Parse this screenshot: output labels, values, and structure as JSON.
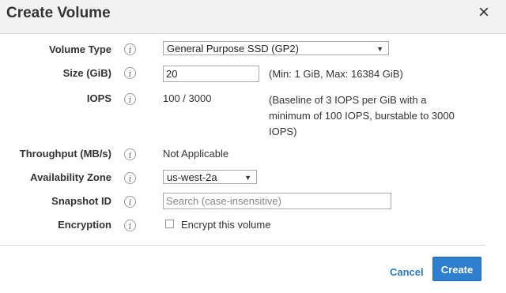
{
  "dialog": {
    "title": "Create Volume",
    "close_glyph": "×"
  },
  "form": {
    "volume_type": {
      "label": "Volume Type",
      "value": "General Purpose SSD (GP2)"
    },
    "size": {
      "label": "Size (GiB)",
      "value": "20",
      "hint": "(Min: 1 GiB, Max: 16384 GiB)"
    },
    "iops": {
      "label": "IOPS",
      "value": "100 / 3000",
      "note": "(Baseline of 3 IOPS per GiB with a minimum of 100 IOPS, burstable to 3000 IOPS)"
    },
    "throughput": {
      "label": "Throughput (MB/s)",
      "value": "Not Applicable"
    },
    "availability_zone": {
      "label": "Availability Zone",
      "value": "us-west-2a"
    },
    "snapshot_id": {
      "label": "Snapshot ID",
      "placeholder": "Search (case-insensitive)"
    },
    "encryption": {
      "label": "Encryption",
      "checkbox_label": "Encrypt this volume",
      "checked": false
    }
  },
  "footer": {
    "cancel_label": "Cancel",
    "create_label": "Create"
  },
  "icons": {
    "info_glyph": "i",
    "dropdown_glyph": "▼"
  },
  "colors": {
    "primary": "#2e7fd0",
    "link": "#2a7bc0",
    "header_bg": "#f2f2f2"
  }
}
